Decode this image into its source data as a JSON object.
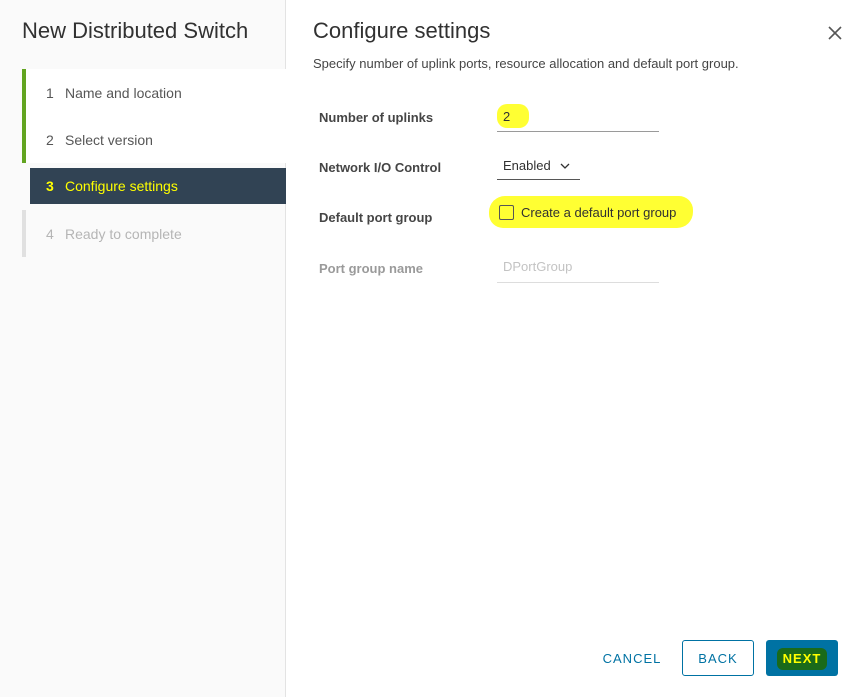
{
  "wizard": {
    "title": "New Distributed Switch",
    "steps": [
      {
        "num": "1",
        "label": "Name and location",
        "state": "done"
      },
      {
        "num": "2",
        "label": "Select version",
        "state": "done"
      },
      {
        "num": "3",
        "label": "Configure settings",
        "state": "active"
      },
      {
        "num": "4",
        "label": "Ready to complete",
        "state": "future"
      }
    ]
  },
  "page": {
    "title": "Configure settings",
    "subtitle": "Specify number of uplink ports, resource allocation and default port group.",
    "close_icon": "close-icon"
  },
  "form": {
    "uplinks": {
      "label": "Number of uplinks",
      "value": "2"
    },
    "nioc": {
      "label": "Network I/O Control",
      "value": "Enabled"
    },
    "default_pg": {
      "label": "Default port group",
      "checkbox_label": "Create a default port group",
      "checked": false
    },
    "pg_name": {
      "label": "Port group name",
      "placeholder": "DPortGroup"
    }
  },
  "footer": {
    "cancel_label": "CANCEL",
    "back_label": "BACK",
    "next_label": "NEXT"
  },
  "colors": {
    "accent": "#0072a3",
    "done_rail": "#62a420",
    "active_step_bg": "#314354",
    "highlight": "#ffff33"
  }
}
